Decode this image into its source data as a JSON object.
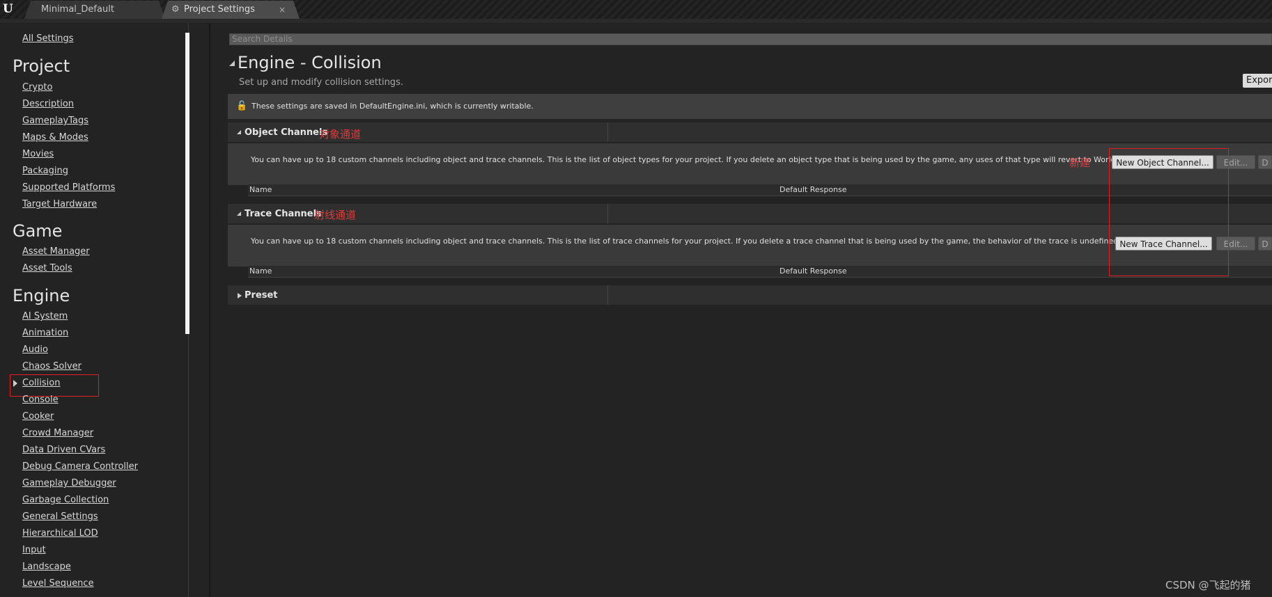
{
  "tabs": [
    {
      "label": "Minimal_Default"
    },
    {
      "label": "Project Settings",
      "close": "×"
    }
  ],
  "sidebar": {
    "all_settings": "All Settings",
    "sections": [
      {
        "heading": "Project",
        "items": [
          "Crypto",
          "Description",
          "GameplayTags",
          "Maps & Modes",
          "Movies",
          "Packaging",
          "Supported Platforms",
          "Target Hardware"
        ]
      },
      {
        "heading": "Game",
        "items": [
          "Asset Manager",
          "Asset Tools"
        ]
      },
      {
        "heading": "Engine",
        "items": [
          "AI System",
          "Animation",
          "Audio",
          "Chaos Solver",
          "Collision",
          "Console",
          "Cooker",
          "Crowd Manager",
          "Data Driven CVars",
          "Debug Camera Controller",
          "Gameplay Debugger",
          "Garbage Collection",
          "General Settings",
          "Hierarchical LOD",
          "Input",
          "Landscape",
          "Level Sequence"
        ]
      }
    ],
    "selected": "Collision"
  },
  "main": {
    "search_placeholder": "Search Details",
    "title": "Engine - Collision",
    "subtitle": "Set up and modify collision settings.",
    "export_label": "Export...",
    "notice": "These settings are saved in DefaultEngine.ini, which is currently writable.",
    "object_channels": {
      "label": "Object Channels",
      "annotation": "对象通道",
      "description": "You can have up to 18 custom channels including object and trace channels. This is the list of object types for your project. If you delete an object type that is being used by the game, any uses of that type will revert to WorldStatic.",
      "annotation_new": "新建",
      "new_button": "New Object Channel...",
      "edit_button": "Edit...",
      "delete_button": "D",
      "col_name": "Name",
      "col_default": "Default Response"
    },
    "trace_channels": {
      "label": "Trace Channels",
      "annotation": "射线通道",
      "description": "You can have up to 18 custom channels including object and trace channels. This is the list of trace channels for your project. If you delete a trace channel that is being used by the game, the behavior of the trace is undefined.",
      "new_button": "New Trace Channel...",
      "edit_button": "Edit...",
      "delete_button": "D",
      "col_name": "Name",
      "col_default": "Default Response"
    },
    "preset": {
      "label": "Preset"
    }
  },
  "watermark": "CSDN @飞起的猪",
  "colors": {
    "accent_annotation": "#e23a3a",
    "background": "#232323"
  }
}
